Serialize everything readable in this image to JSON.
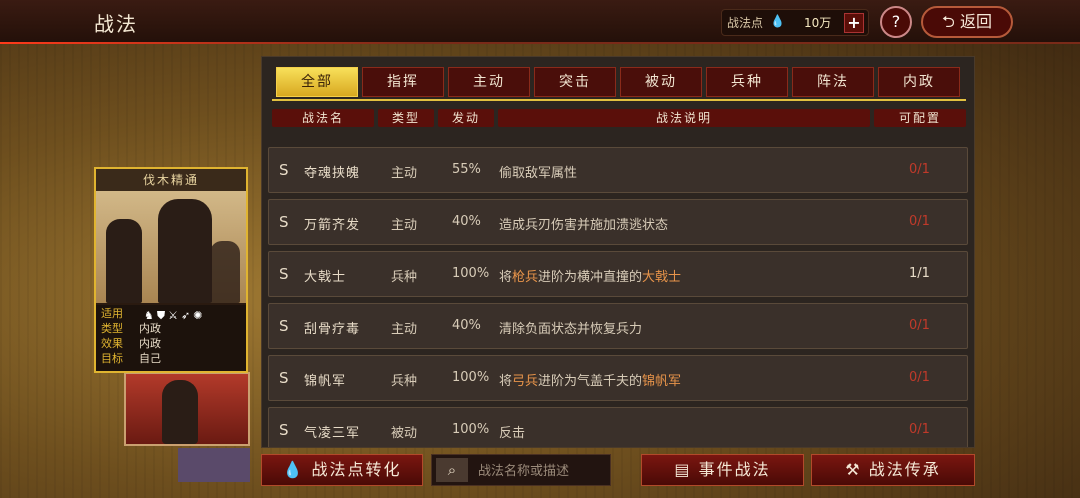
{
  "header": {
    "title": "战法",
    "points_label": "战法点",
    "points_icon": "fire-drop-icon",
    "points_value": "10万",
    "add_label": "+",
    "help_label": "?",
    "back_label": "返回"
  },
  "card": {
    "title": "伐木精通",
    "info": [
      {
        "key": "适用",
        "value": ""
      },
      {
        "key": "类型",
        "value": "内政"
      },
      {
        "key": "效果",
        "value": "内政"
      },
      {
        "key": "目标",
        "value": "自己"
      }
    ],
    "unit_icons": [
      "cavalry-icon",
      "shield-icon",
      "crossed-swords-icon",
      "arrow-icon",
      "wheel-icon"
    ]
  },
  "tabs": [
    "全部",
    "指挥",
    "主动",
    "突击",
    "被动",
    "兵种",
    "阵法",
    "内政"
  ],
  "columns": [
    "战法名",
    "类型",
    "发动",
    "战法说明",
    "可配置"
  ],
  "skills": [
    {
      "grade": "S",
      "name": "夺魂挟魄",
      "type": "主动",
      "rate": "55%",
      "desc": [
        {
          "t": "偷取敌军属性"
        }
      ],
      "config": "0/1"
    },
    {
      "grade": "S",
      "name": "万箭齐发",
      "type": "主动",
      "rate": "40%",
      "desc": [
        {
          "t": "造成兵刃伤害并施加溃逃状态"
        }
      ],
      "config": "0/1"
    },
    {
      "grade": "S",
      "name": "大戟士",
      "type": "兵种",
      "rate": "100%",
      "desc": [
        {
          "t": "将"
        },
        {
          "t": "枪兵",
          "hl": true
        },
        {
          "t": "进阶为横冲直撞的"
        },
        {
          "t": "大戟士",
          "hl": true
        }
      ],
      "config": "1/1"
    },
    {
      "grade": "S",
      "name": "刮骨疗毒",
      "type": "主动",
      "rate": "40%",
      "desc": [
        {
          "t": "清除负面状态并恢复兵力"
        }
      ],
      "config": "0/1"
    },
    {
      "grade": "S",
      "name": "锦帆军",
      "type": "兵种",
      "rate": "100%",
      "desc": [
        {
          "t": "将"
        },
        {
          "t": "弓兵",
          "hl": true
        },
        {
          "t": "进阶为气盖千夫的"
        },
        {
          "t": "锦帆军",
          "hl": true
        }
      ],
      "config": "0/1"
    },
    {
      "grade": "S",
      "name": "气凌三军",
      "type": "被动",
      "rate": "100%",
      "desc": [
        {
          "t": "反击"
        }
      ],
      "config": "0/1"
    }
  ],
  "bottom": {
    "convert_label": "战法点转化",
    "convert_icon": "fire-drop-icon",
    "search_placeholder": "战法名称或描述",
    "event_label": "事件战法",
    "event_icon": "scroll-icon",
    "inherit_label": "战法传承",
    "inherit_icon": "hammer-icon"
  },
  "colors": {
    "accent_gold": "#e2c040",
    "tab_red": "#4a0e0a",
    "highlight_orange": "#e8944a",
    "config_red": "#c03a2a"
  }
}
